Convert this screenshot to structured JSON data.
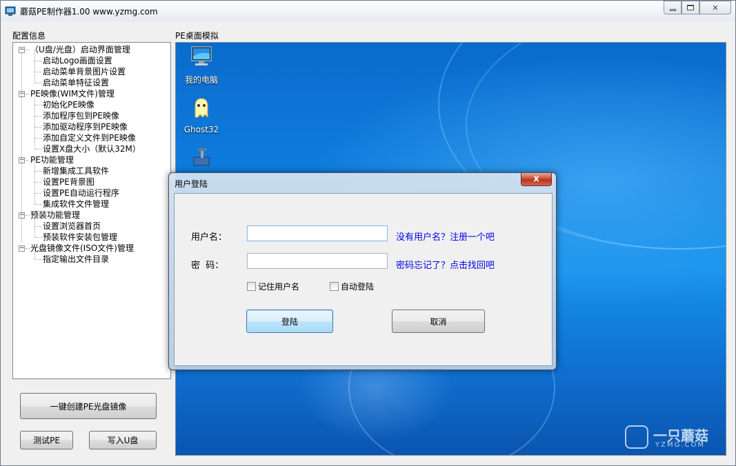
{
  "window": {
    "title": "蘑菇PE制作器1.00 www.yzmg.com",
    "min_symbol": "▭",
    "max_symbol": "▢",
    "close_symbol": "✕"
  },
  "left_panel": {
    "label": "配置信息",
    "tree": [
      {
        "label": "（U盘/光盘）启动界面管理",
        "level": 0,
        "expanded": true,
        "expander": "⊟"
      },
      {
        "label": "启动Logo画面设置",
        "level": 1
      },
      {
        "label": "启动菜单背景图片设置",
        "level": 1
      },
      {
        "label": "启动菜单特征设置",
        "level": 1
      },
      {
        "label": "PE映像(WIM文件)管理",
        "level": 0,
        "expanded": true,
        "expander": "⊟"
      },
      {
        "label": "初始化PE映像",
        "level": 1
      },
      {
        "label": "添加程序包到PE映像",
        "level": 1
      },
      {
        "label": "添加驱动程序到PE映像",
        "level": 1
      },
      {
        "label": "添加自定义文件到PE映像",
        "level": 1
      },
      {
        "label": "设置X盘大小（默认32M）",
        "level": 1
      },
      {
        "label": "PE功能管理",
        "level": 0,
        "expanded": true,
        "expander": "⊟"
      },
      {
        "label": "新增集成工具软件",
        "level": 1
      },
      {
        "label": "设置PE背景图",
        "level": 1
      },
      {
        "label": "设置PE自动运行程序",
        "level": 1
      },
      {
        "label": "集成软件文件管理",
        "level": 1
      },
      {
        "label": "预装功能管理",
        "level": 0,
        "expanded": true,
        "expander": "⊟"
      },
      {
        "label": "设置浏览器首页",
        "level": 1
      },
      {
        "label": "预装软件安装包管理",
        "level": 1
      },
      {
        "label": "光盘镜像文件(ISO文件)管理",
        "level": 0,
        "expanded": true,
        "expander": "⊟"
      },
      {
        "label": "指定输出文件目录",
        "level": 1
      }
    ],
    "buttons": {
      "create_iso": "一键创建PE光盘镜像",
      "test_pe": "测试PE",
      "write_usb": "写入U盘"
    }
  },
  "desktop": {
    "label": "PE桌面模拟",
    "icons": [
      {
        "label": "我的电脑",
        "icon": "computer-icon"
      },
      {
        "label": "Ghost32",
        "icon": "ghost-icon"
      },
      {
        "label": "",
        "icon": "tools-icon"
      }
    ],
    "watermark": {
      "main": "一只蘑菇",
      "sub": "YZMG.COM"
    }
  },
  "dialog": {
    "title": "用户登陆",
    "close_symbol": "x",
    "username_label": "用户名：",
    "username_value": "",
    "password_label": "密  码：",
    "password_value": "",
    "register_link": "没有用户名？注册一个吧",
    "forgot_link": "密码忘记了？点击找回吧",
    "remember_label": "记住用户名",
    "auto_login_label": "自动登陆",
    "login_button": "登陆",
    "cancel_button": "取消"
  },
  "colors": {
    "link": "#0000ee",
    "close_button": "#c7432f",
    "desktop_blue": "#0f7fe0"
  }
}
